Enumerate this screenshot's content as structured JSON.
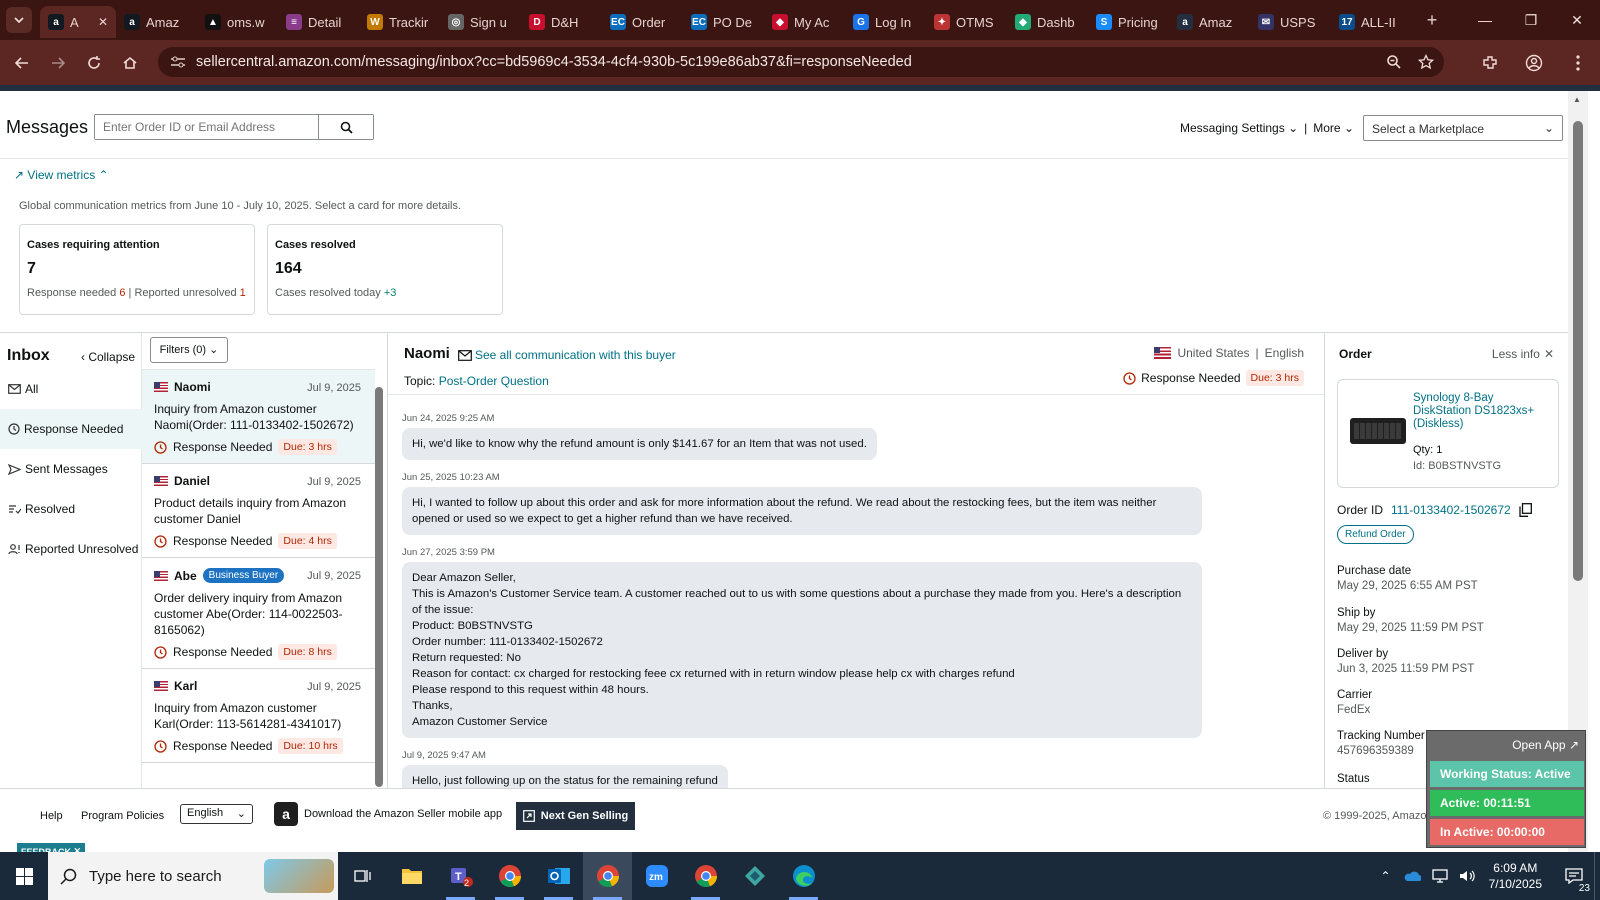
{
  "tabs": [
    {
      "title": "A",
      "fav": "a",
      "color": "#131921",
      "active": true
    },
    {
      "title": "Amaz",
      "fav": "a",
      "color": "#131921"
    },
    {
      "title": "oms.w",
      "fav": "▲",
      "color": "#111"
    },
    {
      "title": "Detail",
      "fav": "≡",
      "color": "#8b3b8b"
    },
    {
      "title": "Trackir",
      "fav": "W",
      "color": "#c27a00"
    },
    {
      "title": "Sign u",
      "fav": "◎",
      "color": "#666"
    },
    {
      "title": "D&H",
      "fav": "D",
      "color": "#c8102e"
    },
    {
      "title": "Order",
      "fav": "EC",
      "color": "#0a6ebd"
    },
    {
      "title": "PO De",
      "fav": "EC",
      "color": "#0a6ebd"
    },
    {
      "title": "My Ac",
      "fav": "◆",
      "color": "#c8102e"
    },
    {
      "title": "Log In",
      "fav": "G",
      "color": "#1a73e8"
    },
    {
      "title": "OTMS",
      "fav": "✦",
      "color": "#b33"
    },
    {
      "title": "Dashb",
      "fav": "◆",
      "color": "#2a7"
    },
    {
      "title": "Pricing",
      "fav": "S",
      "color": "#1a8cff"
    },
    {
      "title": "Amaz",
      "fav": "a",
      "color": "#232f3e"
    },
    {
      "title": "USPS",
      "fav": "✉",
      "color": "#333366"
    },
    {
      "title": "ALL-II",
      "fav": "17",
      "color": "#0a4c8c"
    }
  ],
  "url": "sellercentral.amazon.com/messaging/inbox?cc=bd5969c4-3534-4cf4-930b-5c199e86ab37&fi=responseNeeded",
  "header": {
    "title": "Messages",
    "search_placeholder": "Enter Order ID or Email Address",
    "settings": "Messaging Settings",
    "sep": "|",
    "more": "More",
    "marketplace": "Select a Marketplace"
  },
  "metrics": {
    "toggle": "View metrics",
    "description": "Global communication metrics from June 10 - July 10, 2025. Select a card for more details.",
    "attention": {
      "title": "Cases requiring attention",
      "value": "7",
      "needed_label": "Response needed",
      "needed": "6",
      "sep": "|",
      "unresolved_label": "Reported unresolved",
      "unresolved": "1"
    },
    "resolved": {
      "title": "Cases resolved",
      "value": "164",
      "today_label": "Cases resolved today",
      "today": "+3"
    }
  },
  "inbox": {
    "title": "Inbox",
    "collapse": "Collapse",
    "folders": [
      "All",
      "Response Needed",
      "Sent Messages",
      "Resolved",
      "Reported Unresolved"
    ],
    "filters": "Filters (0)"
  },
  "conversations": [
    {
      "name": "Naomi",
      "date": "Jul 9, 2025",
      "snippet": "Inquiry from Amazon customer Naomi(Order: 111-0133402-1502672)",
      "status": "Response Needed",
      "due": "Due: 3 hrs"
    },
    {
      "name": "Daniel",
      "date": "Jul 9, 2025",
      "snippet": "Product details inquiry from Amazon customer Daniel",
      "status": "Response Needed",
      "due": "Due: 4 hrs"
    },
    {
      "name": "Abe",
      "badge": "Business Buyer",
      "date": "Jul 9, 2025",
      "snippet": "Order delivery inquiry from Amazon customer Abe(Order: 114-0022503-8165062)",
      "status": "Response Needed",
      "due": "Due: 8 hrs"
    },
    {
      "name": "Karl",
      "date": "Jul 9, 2025",
      "snippet": "Inquiry from Amazon customer Karl(Order: 113-5614281-4341017)",
      "status": "Response Needed",
      "due": "Due: 10 hrs"
    }
  ],
  "thread": {
    "buyer": "Naomi",
    "see_all": "See all communication with this buyer",
    "country": "United States",
    "sep": "|",
    "language": "English",
    "topic_label": "Topic:",
    "topic": "Post-Order Question",
    "status": "Response Needed",
    "due": "Due: 3 hrs",
    "messages": [
      {
        "time": "Jun 24, 2025 9:25 AM",
        "text": "Hi, we'd like to know why the refund amount is only $141.67 for an Item that was not used."
      },
      {
        "time": "Jun 25, 2025 10:23 AM",
        "text": "Hi, I wanted to follow up about this order and ask for more information about the refund. We read about the restocking fees, but the item was neither opened or used so we expect to get a higher refund than we have received."
      },
      {
        "time": "Jun 27, 2025 3:59 PM",
        "text": "Dear Amazon Seller,\nThis is Amazon's Customer Service team. A customer reached out to us with some questions about a purchase they made from you. Here's a description of the issue:\nProduct: B0BSTNVSTG\nOrder number: 111-0133402-1502672\nReturn requested: No\nReason for contact: cx charged for restocking feee cx returned with in return window please help cx with charges refund\nPlease respond to this request within 48 hours.\nThanks,\nAmazon Customer Service"
      },
      {
        "time": "Jul 9, 2025 9:47 AM",
        "text": "Hello, just following up on the status for the remaining refund"
      }
    ]
  },
  "order": {
    "title": "Order",
    "less_info": "Less info",
    "product_name": "Synology 8-Bay DiskStation DS1823xs+ (Diskless)",
    "qty": "Qty: 1",
    "id": "Id: B0BSTNVSTG",
    "order_id_label": "Order ID",
    "order_id": "111-0133402-1502672",
    "refund_button": "Refund Order",
    "fields": [
      {
        "label": "Purchase date",
        "value": "May 29, 2025 6:55 AM PST"
      },
      {
        "label": "Ship by",
        "value": "May 29, 2025 11:59 PM PST"
      },
      {
        "label": "Deliver by",
        "value": "Jun 3, 2025 11:59 PM PST"
      },
      {
        "label": "Carrier",
        "value": "FedEx"
      },
      {
        "label": "Tracking Number",
        "value": "457696359389"
      },
      {
        "label": "Status",
        "value": ""
      }
    ]
  },
  "footer": {
    "help": "Help",
    "policies": "Program Policies",
    "language": "English",
    "mobile": "Download the Amazon Seller mobile app",
    "next_gen": "Next Gen Selling",
    "copyright": "© 1999-2025, Amazo"
  },
  "feedback": "FEEDBACK",
  "widget": {
    "open_app": "Open App",
    "working": "Working Status: Active",
    "active": "Active: 00:11:51",
    "inactive": "In Active: 00:00:00",
    "colors": {
      "working": "#5cc4a8",
      "active": "#2ebd59",
      "inactive": "#e86a66"
    }
  },
  "taskbar": {
    "search": "Type here to search",
    "time": "6:09 AM",
    "date": "7/10/2025",
    "teams_badge": "2",
    "notif_count": "23"
  }
}
